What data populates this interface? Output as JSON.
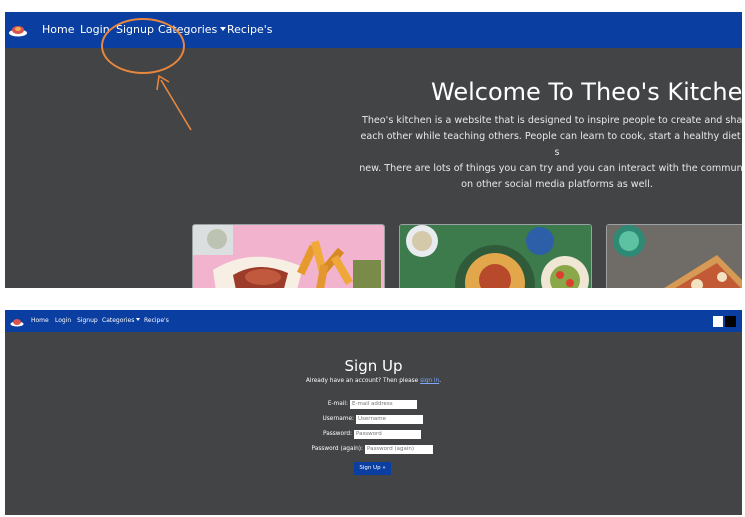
{
  "top_screenshot": {
    "nav": {
      "items": [
        {
          "label": "Home"
        },
        {
          "label": "Login"
        },
        {
          "label": "Signup"
        },
        {
          "label": "Categories"
        },
        {
          "label": "Recipe's"
        }
      ]
    },
    "hero": {
      "title": "Welcome To Theo's Kitche",
      "text_lines": [
        "Theo's kitchen is a website that is designed to inspire people to create and share",
        "each other while teaching others. People can learn to cook, start a healthy diet or s",
        "new. There are lots of things you can try and you can interact with the community",
        "on other social media platforms as well."
      ]
    },
    "cards": [
      {
        "image": "tacos-with-fries"
      },
      {
        "image": "spaghetti-bolognese"
      },
      {
        "image": "pizza"
      }
    ],
    "annotation": {
      "color": "#e8863d"
    }
  },
  "bottom_screenshot": {
    "nav": {
      "items": [
        {
          "label": "Home"
        },
        {
          "label": "Login"
        },
        {
          "label": "Signup"
        },
        {
          "label": "Categories"
        },
        {
          "label": "Recipe's"
        }
      ]
    },
    "signup": {
      "title": "Sign Up",
      "note_prefix": "Already have an account? Then please ",
      "note_link": "sign in",
      "note_suffix": ".",
      "fields": [
        {
          "label": "E-mail:",
          "placeholder": "E-mail address"
        },
        {
          "label": "Username:",
          "placeholder": "Username"
        },
        {
          "label": "Password:",
          "placeholder": "Password"
        },
        {
          "label": "Password (again):",
          "placeholder": "Password (again)"
        }
      ],
      "button": "Sign Up »"
    }
  },
  "colors": {
    "navbar": "#0a3ea1",
    "background": "#424446",
    "annotation": "#e8863d"
  }
}
